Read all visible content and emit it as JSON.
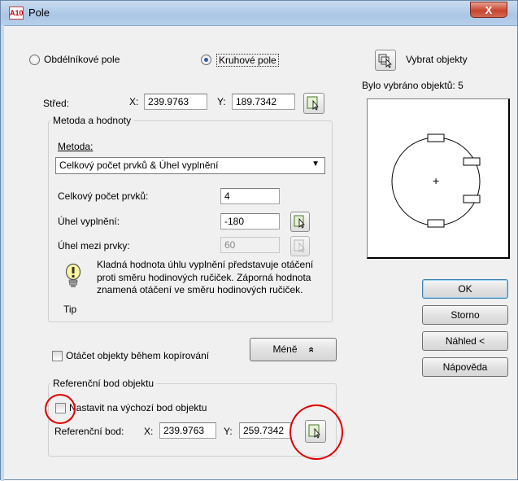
{
  "window": {
    "title": "Pole",
    "app_icon": "A10",
    "close_glyph": "X"
  },
  "array_type": {
    "rect_label": "Obdélníkové pole",
    "polar_label": "Kruhové pole",
    "selected": "polar"
  },
  "select_objects": {
    "button_label": "Vybrat objekty",
    "status": "Bylo vybráno objektů: 5"
  },
  "center": {
    "label": "Střed:",
    "x_label": "X:",
    "x_value": "239.9763",
    "y_label": "Y:",
    "y_value": "189.7342"
  },
  "method_group": {
    "title": "Metoda a hodnoty",
    "method_label": "Metoda:",
    "method_value": "Celkový počet prvků & Úhel vyplnění",
    "total_items_label": "Celkový počet prvků:",
    "total_items_value": "4",
    "fill_angle_label": "Úhel vyplnění:",
    "fill_angle_value": "-180",
    "angle_between_label": "Úhel mezi prvky:",
    "angle_between_value": "60",
    "tip_label": "Tip",
    "tip_text": "Kladná hodnota úhlu vyplnění představuje otáčení proti směru hodinových ručiček. Záporná hodnota znamená otáčení ve směru hodinových ručiček."
  },
  "rotate_items": {
    "label": "Otáčet objekty během kopírování",
    "checked": false
  },
  "less_button": {
    "label": "Méně",
    "glyph": "»"
  },
  "base_point_group": {
    "title": "Referenční bod objektu",
    "default_label": "Nastavit na výchozí bod objektu",
    "default_checked": false,
    "ref_label": "Referenční bod:",
    "x_label": "X:",
    "x_value": "239.9763",
    "y_label": "Y:",
    "y_value": "259.7342"
  },
  "buttons": {
    "ok": "OK",
    "cancel": "Storno",
    "preview": "Náhled <",
    "help": "Nápověda"
  },
  "preview_pane": {
    "center_mark": "+",
    "item_count": 4
  },
  "colors": {
    "accent": "#2b5dae",
    "highlight": "#e00000",
    "title_bar": "#aac6e6"
  }
}
